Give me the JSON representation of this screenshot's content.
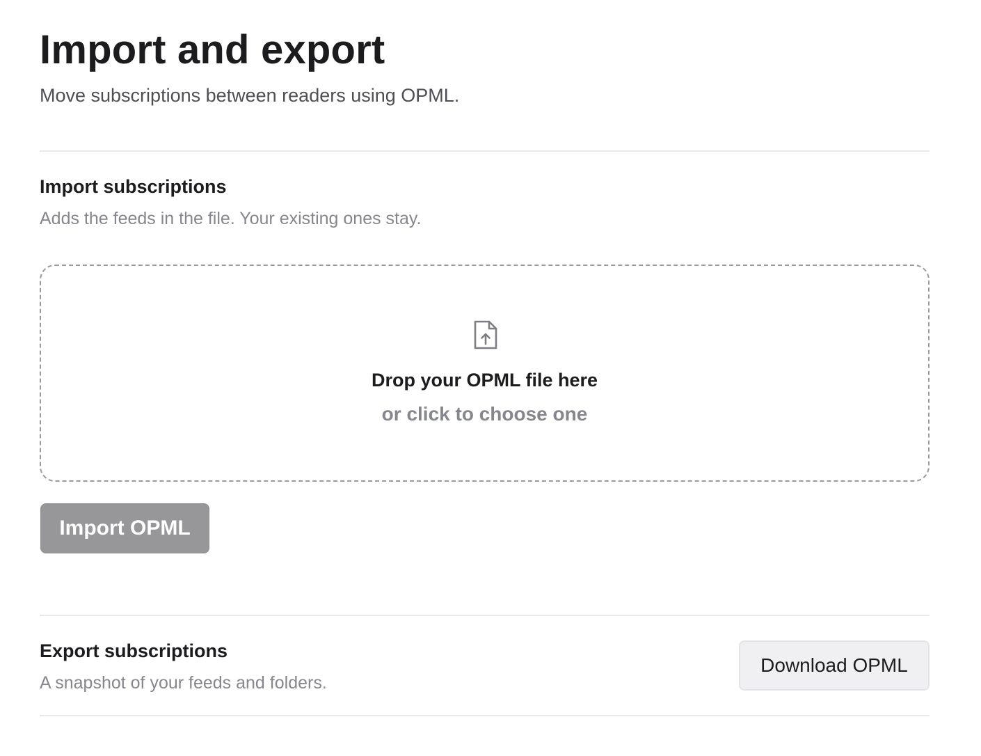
{
  "header": {
    "title": "Import and export",
    "subtitle": "Move subscriptions between readers using OPML."
  },
  "import_section": {
    "heading": "Import subscriptions",
    "description": "Adds the feeds in the file. Your existing ones stay.",
    "dropzone": {
      "icon": "file-upload-icon",
      "title": "Drop your OPML file here",
      "hint": "or click to choose one"
    },
    "button_label": "Import OPML",
    "button_state": "disabled"
  },
  "export_section": {
    "heading": "Export subscriptions",
    "description": "A snapshot of your feeds and folders.",
    "button_label": "Download OPML"
  },
  "colors": {
    "text_primary": "#1c1c1f",
    "text_muted": "#86868e",
    "disabled_button": "#97979a",
    "secondary_button": "#f0f0f2",
    "divider": "#e9e9ec"
  }
}
